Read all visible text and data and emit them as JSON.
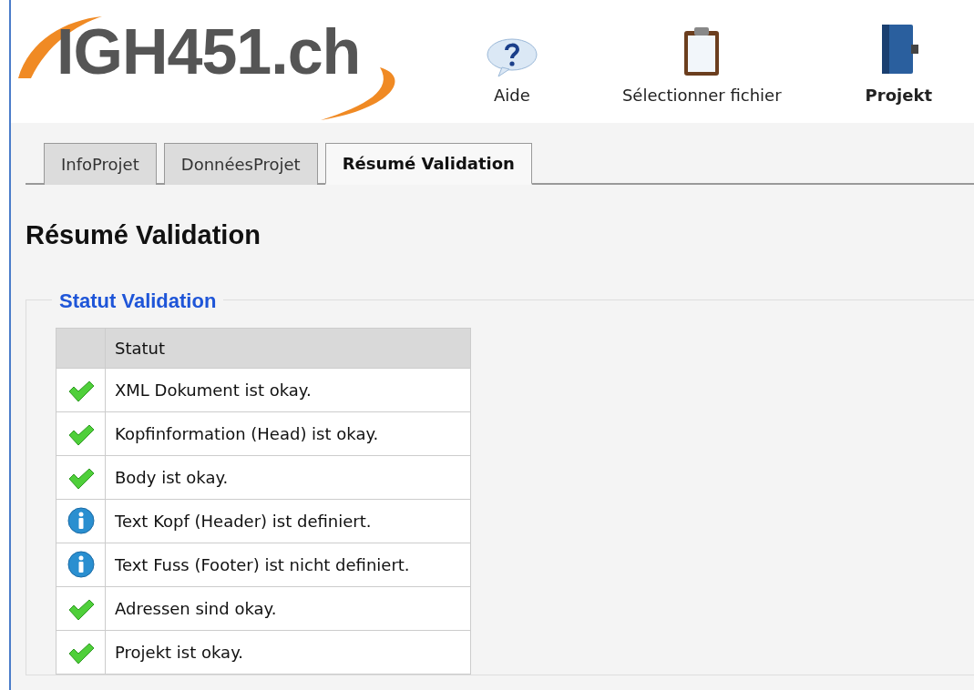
{
  "logo": {
    "text": "IGH451.ch"
  },
  "toolbar": [
    {
      "label": "Aide",
      "kind": "help",
      "bold": false
    },
    {
      "label": "Sélectionner fichier",
      "kind": "clipboard",
      "bold": false
    },
    {
      "label": "Projekt",
      "kind": "book",
      "bold": true
    }
  ],
  "tabs": [
    {
      "label": "InfoProjet",
      "selected": false
    },
    {
      "label": "DonnéesProjet",
      "selected": false
    },
    {
      "label": "Résumé Validation",
      "selected": true
    }
  ],
  "heading": "Résumé Validation",
  "fieldset": {
    "legend": "Statut Validation",
    "table": {
      "columns": [
        "Statut"
      ],
      "rows": [
        {
          "kind": "ok",
          "text": "XML Dokument ist okay."
        },
        {
          "kind": "ok",
          "text": "Kopfinformation (Head) ist okay."
        },
        {
          "kind": "ok",
          "text": "Body ist okay."
        },
        {
          "kind": "info",
          "text": "Text Kopf (Header) ist definiert."
        },
        {
          "kind": "info",
          "text": "Text Fuss (Footer) ist nicht definiert."
        },
        {
          "kind": "ok",
          "text": "Adressen sind okay."
        },
        {
          "kind": "ok",
          "text": "Projekt ist okay."
        }
      ]
    }
  }
}
